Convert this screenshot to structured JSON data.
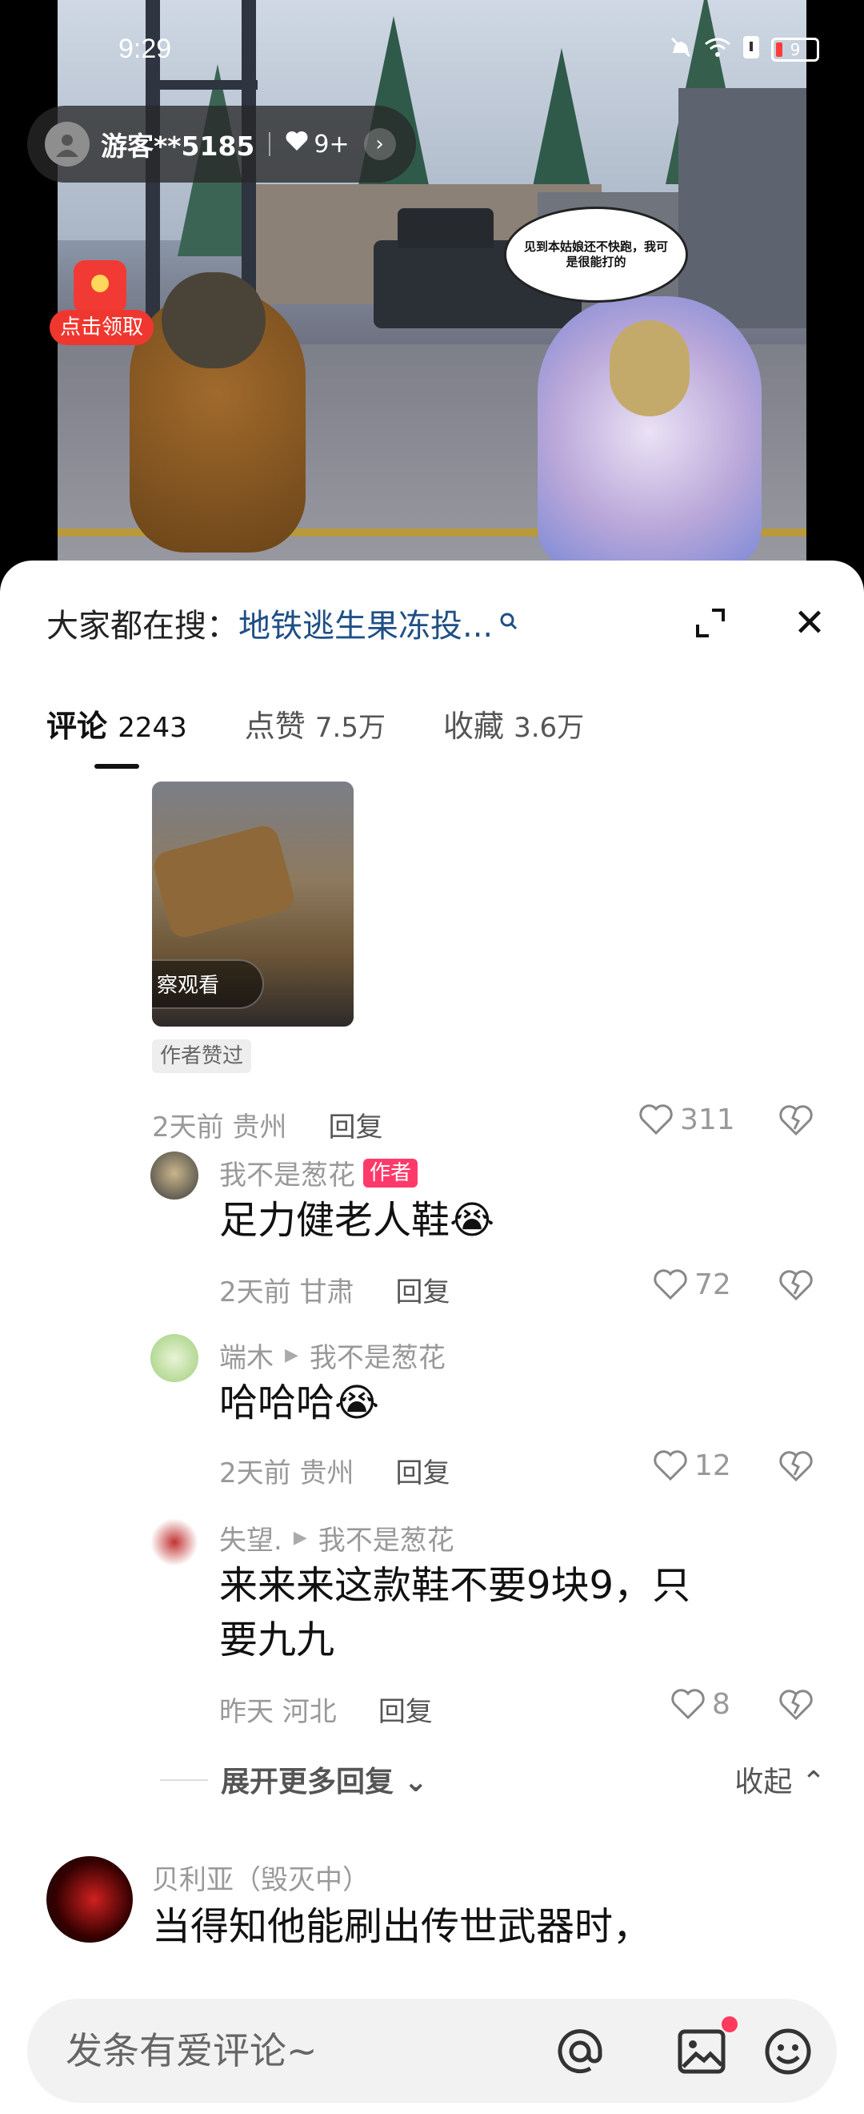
{
  "status_bar": {
    "time": "9:29",
    "battery": "9"
  },
  "guest": {
    "name": "游客**5185",
    "likes": "9+"
  },
  "envelope": {
    "label": "点击领取"
  },
  "bubble_text": "见到本姑娘还不快跑，我可是很能打的",
  "search": {
    "label": "大家都在搜：",
    "query": "地铁逃生果冻投..."
  },
  "tabs": [
    {
      "label": "评论",
      "count": "2243"
    },
    {
      "label": "点赞",
      "count": "7.5万"
    },
    {
      "label": "收藏",
      "count": "3.6万"
    }
  ],
  "top_comment": {
    "watch_label": "察观看",
    "author_liked": "作者赞过",
    "meta": {
      "time": "2天前",
      "location": "贵州",
      "reply": "回复"
    },
    "likes": "311"
  },
  "replies": [
    {
      "user": "我不是葱花",
      "badge": "作者",
      "text": "足力健老人鞋😭",
      "time": "2天前",
      "location": "甘肃",
      "reply": "回复",
      "likes": "72"
    },
    {
      "user": "端木",
      "to": "我不是葱花",
      "text": "哈哈哈😭",
      "time": "2天前",
      "location": "贵州",
      "reply": "回复",
      "likes": "12"
    },
    {
      "user": "失望.",
      "to": "我不是葱花",
      "text_line1": "来来来这款鞋不要9块9，只",
      "text_line2": "要九九",
      "time": "昨天",
      "location": "河北",
      "reply": "回复",
      "likes": "8"
    }
  ],
  "more_replies": {
    "expand": "展开更多回复",
    "collapse": "收起"
  },
  "next_comment": {
    "user": "贝利亚（毁灭中）",
    "text": "当得知他能刷出传世武器时，"
  },
  "input": {
    "placeholder": "发条有爱评论~"
  },
  "colors": {
    "accent_link": "#1f4f86",
    "author_badge": "#ff3a6b",
    "envelope_red": "#f0372f"
  }
}
